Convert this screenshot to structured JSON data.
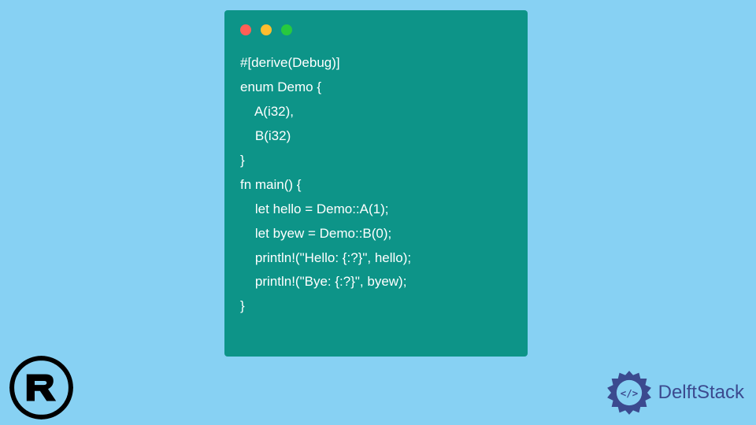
{
  "code": {
    "lines": [
      "#[derive(Debug)]",
      "enum Demo {",
      "    A(i32),",
      "    B(i32)",
      "}",
      "fn main() {",
      "    let hello = Demo::A(1);",
      "    let byew = Demo::B(0);",
      "    println!(\"Hello: {:?}\", hello);",
      "    println!(\"Bye: {:?}\", byew);",
      "}"
    ]
  },
  "logos": {
    "rust": "Rust",
    "delftstack": "DelftStack"
  },
  "colors": {
    "background": "#87d1f3",
    "codeBackground": "#0d9488",
    "codeText": "#ffffff",
    "trafficRed": "#ff5f56",
    "trafficYellow": "#ffbd2e",
    "trafficGreen": "#27c93f",
    "delftBlue": "#3b4a8f"
  }
}
